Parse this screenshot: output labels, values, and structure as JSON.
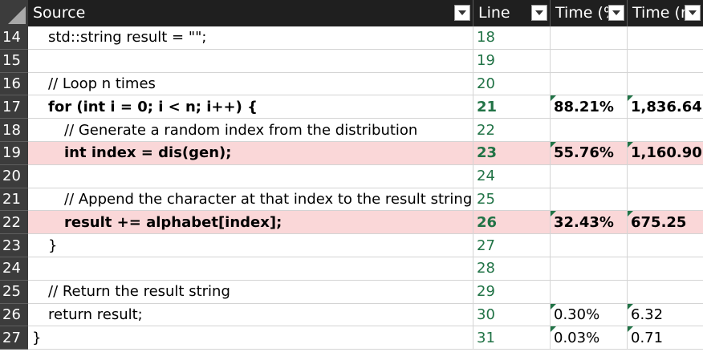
{
  "header": {
    "columns": [
      {
        "label": "Source"
      },
      {
        "label": "Line"
      },
      {
        "label": "Time (%"
      },
      {
        "label": "Time (n"
      }
    ]
  },
  "rows": [
    {
      "num": "14",
      "indent": 1,
      "source": "std::string result = \"\";",
      "line": "18",
      "pct": "",
      "ms": "",
      "bold": false,
      "highlight": false
    },
    {
      "num": "15",
      "indent": 1,
      "source": "",
      "line": "19",
      "pct": "",
      "ms": "",
      "bold": false,
      "highlight": false
    },
    {
      "num": "16",
      "indent": 1,
      "source": "// Loop n times",
      "line": "20",
      "pct": "",
      "ms": "",
      "bold": false,
      "highlight": false
    },
    {
      "num": "17",
      "indent": 1,
      "source": "for (int i = 0; i < n; i++) {",
      "line": "21",
      "pct": "88.21%",
      "ms": "1,836.64",
      "bold": true,
      "highlight": false
    },
    {
      "num": "18",
      "indent": 2,
      "source": "// Generate a random index from the distribution",
      "line": "22",
      "pct": "",
      "ms": "",
      "bold": false,
      "highlight": false
    },
    {
      "num": "19",
      "indent": 2,
      "source": "int index = dis(gen);",
      "line": "23",
      "pct": "55.76%",
      "ms": "1,160.90",
      "bold": true,
      "highlight": true
    },
    {
      "num": "20",
      "indent": 2,
      "source": "",
      "line": "24",
      "pct": "",
      "ms": "",
      "bold": false,
      "highlight": false
    },
    {
      "num": "21",
      "indent": 2,
      "source": "// Append the character at that index to the result string",
      "line": "25",
      "pct": "",
      "ms": "",
      "bold": false,
      "highlight": false
    },
    {
      "num": "22",
      "indent": 2,
      "source": "result += alphabet[index];",
      "line": "26",
      "pct": "32.43%",
      "ms": "675.25",
      "bold": true,
      "highlight": true
    },
    {
      "num": "23",
      "indent": 1,
      "source": "}",
      "line": "27",
      "pct": "",
      "ms": "",
      "bold": false,
      "highlight": false
    },
    {
      "num": "24",
      "indent": 1,
      "source": "",
      "line": "28",
      "pct": "",
      "ms": "",
      "bold": false,
      "highlight": false
    },
    {
      "num": "25",
      "indent": 1,
      "source": "// Return the result string",
      "line": "29",
      "pct": "",
      "ms": "",
      "bold": false,
      "highlight": false
    },
    {
      "num": "26",
      "indent": 1,
      "source": "return result;",
      "line": "30",
      "pct": "0.30%",
      "ms": "6.32",
      "bold": false,
      "highlight": false
    },
    {
      "num": "27",
      "indent": 0,
      "source": "}",
      "line": "31",
      "pct": "0.03%",
      "ms": "0.71",
      "bold": false,
      "highlight": false
    }
  ],
  "colors": {
    "line_number_green": "#217346",
    "highlight_row": "#fad7d8",
    "header_bg": "#1f1f1f",
    "rownum_bg": "#3c3c3c"
  },
  "icons": {
    "filter_dropdown": "chevron-down-icon",
    "select_all": "select-all-corner-icon",
    "number_flag": "error-flag-icon"
  }
}
